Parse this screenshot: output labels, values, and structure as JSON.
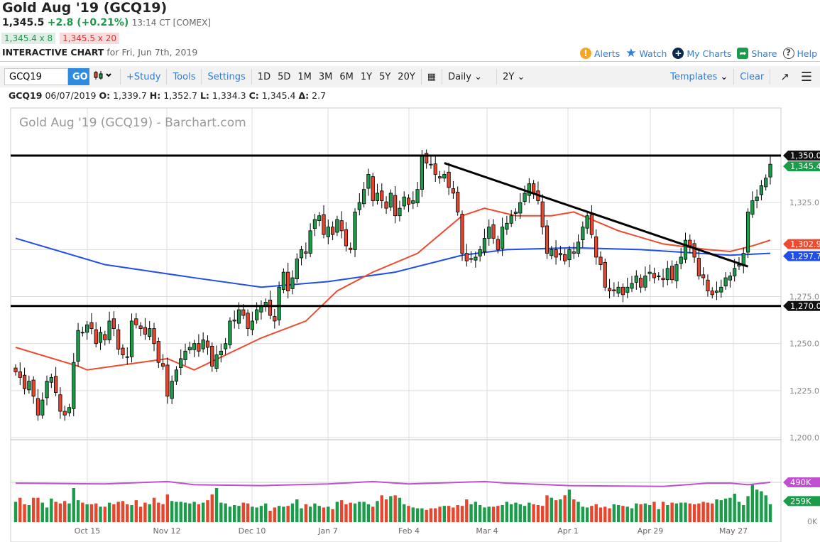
{
  "header": {
    "title": "Gold Aug '19 (GCQ19)",
    "last": "1,345.5",
    "change": "+2.8 (+0.21%)",
    "time": "13:14 CT [COMEX]",
    "bid": "1,345.4 x 8",
    "ask": "1,345.5 x 20",
    "interactive_label": "INTERACTIVE CHART",
    "for_date": "for Fri, Jun 7th, 2019"
  },
  "links": {
    "alerts": "Alerts",
    "watch": "Watch",
    "my_charts": "My Charts",
    "share": "Share",
    "help": "Help"
  },
  "toolbar": {
    "symbol": "GCQ19",
    "go": "GO",
    "study": "+Study",
    "tools": "Tools",
    "settings": "Settings",
    "periods": [
      "1D",
      "5D",
      "1M",
      "3M",
      "6M",
      "1Y",
      "5Y",
      "20Y"
    ],
    "interval": "Daily",
    "range": "2Y",
    "templates": "Templates",
    "clear": "Clear"
  },
  "ohlc": {
    "symbol": "GCQ19",
    "date": "06/07/2019",
    "o_label": "O:",
    "o": "1,339.7",
    "h_label": "H:",
    "h": "1,352.7",
    "l_label": "L:",
    "l": "1,334.3",
    "c_label": "C:",
    "c": "1,345.4",
    "d_label": "Δ:",
    "d": "2.7"
  },
  "colors": {
    "up": "#1a9c4a",
    "down": "#e8452c",
    "ma50": "#ee4a2e",
    "ma200": "#1f4fe8",
    "volma": "#c050d0",
    "link": "#2f7ed8"
  },
  "chart_data": {
    "type": "candlestick",
    "title": "Gold Aug '19 (GCQ19) - Barchart.com",
    "ylim": [
      1200,
      1350
    ],
    "yticks": [
      "1,200.0",
      "1,225.0",
      "1,250.0",
      "1,275.0",
      "1,325.0"
    ],
    "ytick_values": [
      1200,
      1225,
      1250,
      1275,
      1325
    ],
    "xticks": [
      "Oct 15",
      "Nov 12",
      "Dec 10",
      "Jan 7",
      "Feb 4",
      "Mar 4",
      "Apr 1",
      "Apr 29",
      "May 27"
    ],
    "closes": [
      1235,
      1232,
      1226,
      1230,
      1222,
      1212,
      1220,
      1230,
      1232,
      1224,
      1214,
      1212,
      1216,
      1240,
      1257,
      1256,
      1260,
      1258,
      1250,
      1256,
      1252,
      1262,
      1258,
      1247,
      1244,
      1243,
      1262,
      1260,
      1258,
      1255,
      1258,
      1250,
      1240,
      1238,
      1222,
      1230,
      1236,
      1242,
      1246,
      1248,
      1250,
      1246,
      1252,
      1248,
      1238,
      1244,
      1246,
      1250,
      1262,
      1262,
      1268,
      1265,
      1258,
      1262,
      1268,
      1270,
      1272,
      1265,
      1262,
      1280,
      1288,
      1278,
      1285,
      1295,
      1300,
      1298,
      1310,
      1316,
      1318,
      1308,
      1312,
      1308,
      1316,
      1310,
      1302,
      1300,
      1320,
      1325,
      1332,
      1340,
      1326,
      1330,
      1326,
      1322,
      1330,
      1318,
      1322,
      1328,
      1324,
      1326,
      1332,
      1350,
      1346,
      1345,
      1340,
      1338,
      1340,
      1333,
      1330,
      1320,
      1298,
      1294,
      1295,
      1296,
      1300,
      1306,
      1312,
      1306,
      1300,
      1312,
      1314,
      1318,
      1320,
      1325,
      1330,
      1335,
      1330,
      1326,
      1312,
      1298,
      1300,
      1296,
      1298,
      1294,
      1300,
      1298,
      1304,
      1312,
      1318,
      1308,
      1296,
      1292,
      1280,
      1278,
      1278,
      1280,
      1276,
      1280,
      1282,
      1286,
      1280,
      1286,
      1288,
      1285,
      1286,
      1284,
      1290,
      1284,
      1292,
      1296,
      1305,
      1302,
      1296,
      1286,
      1285,
      1278,
      1276,
      1278,
      1280,
      1285,
      1286,
      1290,
      1292,
      1298,
      1320,
      1326,
      1328,
      1334,
      1338,
      1345.4
    ],
    "volumes_k": [
      250,
      300,
      220,
      210,
      300,
      300,
      240,
      180,
      290,
      250,
      230,
      260,
      230,
      420,
      270,
      240,
      220,
      220,
      230,
      190,
      190,
      240,
      220,
      250,
      260,
      220,
      210,
      270,
      190,
      240,
      220,
      300,
      240,
      220,
      340,
      260,
      250,
      250,
      240,
      230,
      250,
      220,
      240,
      270,
      340,
      420,
      240,
      230,
      190,
      210,
      200,
      240,
      230,
      190,
      180,
      200,
      230,
      140,
      180,
      200,
      190,
      200,
      230,
      280,
      170,
      220,
      190,
      230,
      200,
      180,
      190,
      160,
      250,
      270,
      220,
      240,
      230,
      250,
      250,
      220,
      190,
      260,
      330,
      280,
      320,
      330,
      300,
      220,
      200,
      180,
      170,
      170,
      150,
      170,
      170,
      190,
      200,
      200,
      180,
      210,
      200,
      280,
      220,
      250,
      210,
      180,
      190,
      190,
      200,
      210,
      250,
      220,
      240,
      220,
      200,
      240,
      220,
      210,
      200,
      330,
      300,
      270,
      280,
      330,
      400,
      280,
      250,
      190,
      180,
      200,
      220,
      180,
      190,
      170,
      220,
      210,
      200,
      190,
      170,
      230,
      220,
      230,
      210,
      250,
      160,
      250,
      210,
      240,
      230,
      240,
      240,
      230,
      220,
      230,
      250,
      240,
      230,
      280,
      270,
      290,
      300,
      350,
      250,
      210,
      320,
      460,
      400,
      380,
      330,
      220
    ],
    "ma50": [
      [
        0,
        1248
      ],
      [
        14,
        1238
      ],
      [
        16,
        1236
      ],
      [
        34,
        1242
      ],
      [
        40,
        1236
      ],
      [
        55,
        1253
      ],
      [
        65,
        1262
      ],
      [
        72,
        1278
      ],
      [
        80,
        1288
      ],
      [
        90,
        1298
      ],
      [
        100,
        1318
      ],
      [
        105,
        1322
      ],
      [
        112,
        1318
      ],
      [
        120,
        1318
      ],
      [
        125,
        1320
      ],
      [
        135,
        1310
      ],
      [
        145,
        1303
      ],
      [
        155,
        1300
      ],
      [
        160,
        1299
      ],
      [
        165,
        1302
      ],
      [
        169,
        1305
      ]
    ],
    "ma200": [
      [
        0,
        1306
      ],
      [
        20,
        1292
      ],
      [
        40,
        1285
      ],
      [
        55,
        1280
      ],
      [
        70,
        1283
      ],
      [
        85,
        1288
      ],
      [
        100,
        1297
      ],
      [
        110,
        1300
      ],
      [
        125,
        1301
      ],
      [
        140,
        1300
      ],
      [
        160,
        1297
      ],
      [
        169,
        1298
      ]
    ],
    "vol_ma_k": [
      [
        0,
        480
      ],
      [
        20,
        470
      ],
      [
        34,
        500
      ],
      [
        40,
        460
      ],
      [
        55,
        450
      ],
      [
        70,
        470
      ],
      [
        80,
        500
      ],
      [
        88,
        470
      ],
      [
        105,
        500
      ],
      [
        110,
        480
      ],
      [
        124,
        450
      ],
      [
        145,
        440
      ],
      [
        155,
        480
      ],
      [
        160,
        480
      ],
      [
        164,
        460
      ],
      [
        169,
        490
      ]
    ],
    "support": 1270,
    "resistance": 1350,
    "trendline": [
      [
        96,
        1346
      ],
      [
        164,
        1291
      ]
    ],
    "price_tags": {
      "resistance": "1,350.0",
      "last": "1,345.4",
      "ma50": "1,302.9",
      "ma200": "1,297.7",
      "support": "1,270.0",
      "vol_ma": "490K",
      "vol_last": "259K",
      "vol_zero": "0K"
    },
    "ma50_value": 1302.9,
    "ma200_value": 1297.7,
    "last_value": 1345.4,
    "vol_ma_value": 490,
    "vol_last_value": 259
  }
}
